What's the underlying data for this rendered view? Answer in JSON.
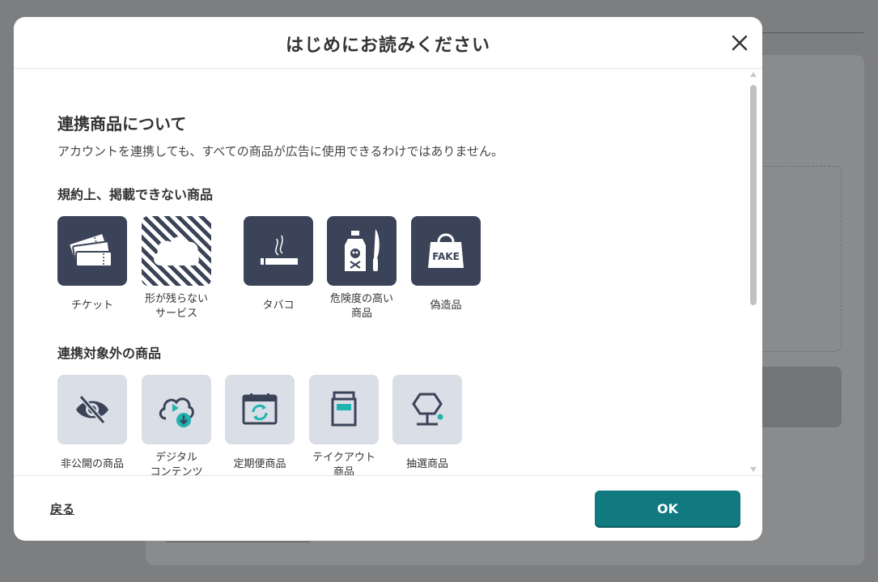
{
  "modal": {
    "title": "はじめにお読みください",
    "close_icon": "close-icon"
  },
  "content": {
    "heading": "連携商品について",
    "lead": "アカウントを連携しても、すべての商品が広告に使用できるわけではありません。",
    "prohibited": {
      "heading": "規約上、掲載できない商品",
      "items": [
        {
          "label": "チケット",
          "icon": "ticket-icon"
        },
        {
          "label_line1": "形が残らない",
          "label_line2": "サービス",
          "icon": "cloud-icon"
        },
        {
          "label": "タバコ",
          "icon": "cigarette-icon"
        },
        {
          "label_line1": "危険度の高い",
          "label_line2": "商品",
          "icon": "poison-knife-icon"
        },
        {
          "label": "偽造品",
          "icon": "fake-bag-icon",
          "badge": "FAKE"
        }
      ]
    },
    "excluded": {
      "heading": "連携対象外の商品",
      "items": [
        {
          "label": "非公開の商品",
          "icon": "eye-off-icon"
        },
        {
          "label_line1": "デジタル",
          "label_line2": "コンテンツ",
          "icon": "cloud-download-icon"
        },
        {
          "label": "定期便商品",
          "icon": "calendar-refresh-icon"
        },
        {
          "label_line1": "テイクアウト",
          "label_line2": "商品",
          "icon": "takeout-bag-icon"
        },
        {
          "label": "抽選商品",
          "icon": "lottery-icon"
        }
      ]
    }
  },
  "footer": {
    "back_label": "戻る",
    "ok_label": "OK"
  },
  "colors": {
    "accent": "#117a80",
    "tile_dark": "#3b4358",
    "tile_light": "#dadee6",
    "teal_dot": "#1fb3b0"
  }
}
